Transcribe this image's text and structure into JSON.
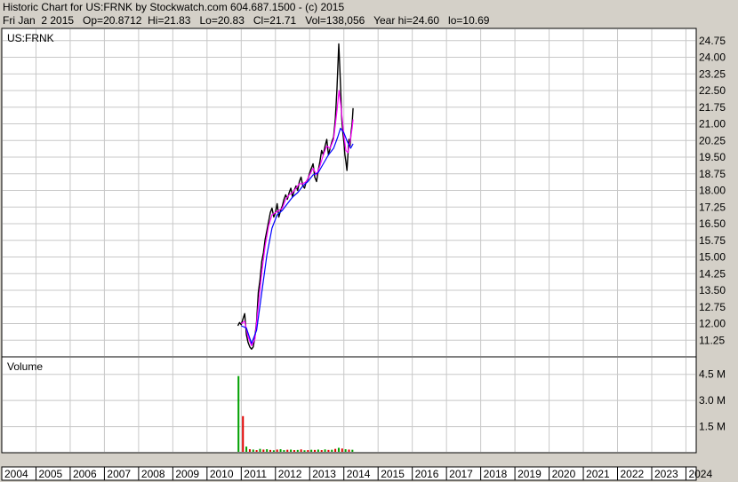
{
  "header": {
    "line1": "Historic Chart for US:FRNK by Stockwatch.com 604.687.1500 - (c) 2015",
    "line2": "Fri Jan  2 2015   Op=20.8712  Hi=21.83   Lo=20.83   Cl=21.71   Vol=138,056   Year hi=24.60   lo=10.69"
  },
  "colors": {
    "background": "#d4d0c8",
    "plot": "#ffffff",
    "grid": "#c8c8c8",
    "price": "#000000",
    "ma_short": "#ff00ff",
    "ma_long": "#0000ff",
    "vol_up": "#00a000",
    "vol_down": "#e00000"
  },
  "chart_data": [
    {
      "type": "line",
      "title": "US:FRNK",
      "y_ticks": [
        "24.75",
        "24.00",
        "23.25",
        "22.50",
        "21.75",
        "21.00",
        "20.25",
        "19.50",
        "18.75",
        "18.00",
        "17.25",
        "16.50",
        "15.75",
        "15.00",
        "14.25",
        "13.50",
        "12.75",
        "12.00",
        "11.25"
      ],
      "ylim": [
        10.5,
        25.3
      ],
      "xlim": [
        2004.0,
        2024.3
      ],
      "grid": true,
      "series": [
        {
          "values": [
            [
              2010.9,
              11.9
            ],
            [
              2010.95,
              12.05
            ],
            [
              2011.0,
              11.95
            ],
            [
              2011.05,
              12.2
            ],
            [
              2011.1,
              12.45
            ],
            [
              2011.15,
              11.5
            ],
            [
              2011.2,
              11.15
            ],
            [
              2011.25,
              10.95
            ],
            [
              2011.3,
              10.85
            ],
            [
              2011.35,
              10.95
            ],
            [
              2011.4,
              11.4
            ],
            [
              2011.45,
              12.1
            ],
            [
              2011.5,
              13.4
            ],
            [
              2011.55,
              14.0
            ],
            [
              2011.6,
              14.8
            ],
            [
              2011.65,
              15.2
            ],
            [
              2011.7,
              15.8
            ],
            [
              2011.75,
              16.2
            ],
            [
              2011.8,
              16.6
            ],
            [
              2011.85,
              17.0
            ],
            [
              2011.9,
              17.2
            ],
            [
              2011.95,
              16.8
            ],
            [
              2012.0,
              17.0
            ],
            [
              2012.05,
              17.4
            ],
            [
              2012.1,
              16.8
            ],
            [
              2012.15,
              17.1
            ],
            [
              2012.2,
              17.3
            ],
            [
              2012.25,
              17.6
            ],
            [
              2012.3,
              17.8
            ],
            [
              2012.35,
              17.6
            ],
            [
              2012.4,
              17.9
            ],
            [
              2012.45,
              18.1
            ],
            [
              2012.5,
              17.7
            ],
            [
              2012.55,
              18.0
            ],
            [
              2012.6,
              18.2
            ],
            [
              2012.65,
              18.0
            ],
            [
              2012.7,
              18.4
            ],
            [
              2012.75,
              18.6
            ],
            [
              2012.8,
              18.2
            ],
            [
              2012.85,
              18.1
            ],
            [
              2012.9,
              18.4
            ],
            [
              2012.95,
              18.5
            ],
            [
              2013.0,
              18.8
            ],
            [
              2013.05,
              19.0
            ],
            [
              2013.1,
              19.2
            ],
            [
              2013.15,
              18.6
            ],
            [
              2013.2,
              18.4
            ],
            [
              2013.25,
              18.9
            ],
            [
              2013.3,
              19.3
            ],
            [
              2013.35,
              19.8
            ],
            [
              2013.4,
              19.6
            ],
            [
              2013.45,
              20.0
            ],
            [
              2013.5,
              20.3
            ],
            [
              2013.55,
              19.6
            ],
            [
              2013.6,
              19.9
            ],
            [
              2013.65,
              20.2
            ],
            [
              2013.7,
              20.4
            ],
            [
              2013.75,
              21.2
            ],
            [
              2013.8,
              22.6
            ],
            [
              2013.85,
              24.6
            ],
            [
              2013.88,
              23.6
            ],
            [
              2013.91,
              22.4
            ],
            [
              2013.94,
              21.2
            ],
            [
              2013.97,
              20.6
            ],
            [
              2014.0,
              20.2
            ],
            [
              2014.03,
              19.6
            ],
            [
              2014.06,
              19.3
            ],
            [
              2014.09,
              18.9
            ],
            [
              2014.12,
              19.6
            ],
            [
              2014.15,
              20.3
            ],
            [
              2014.18,
              20.0
            ],
            [
              2014.21,
              20.6
            ],
            [
              2014.24,
              21.0
            ],
            [
              2014.27,
              21.71
            ]
          ]
        },
        {
          "values": [
            [
              2011.0,
              12.0
            ],
            [
              2011.1,
              12.1
            ],
            [
              2011.2,
              11.4
            ],
            [
              2011.3,
              11.0
            ],
            [
              2011.4,
              11.3
            ],
            [
              2011.5,
              12.8
            ],
            [
              2011.6,
              14.3
            ],
            [
              2011.7,
              15.5
            ],
            [
              2011.8,
              16.4
            ],
            [
              2011.9,
              16.9
            ],
            [
              2012.0,
              17.0
            ],
            [
              2012.1,
              17.1
            ],
            [
              2012.2,
              17.2
            ],
            [
              2012.3,
              17.6
            ],
            [
              2012.4,
              17.8
            ],
            [
              2012.5,
              17.9
            ],
            [
              2012.6,
              18.1
            ],
            [
              2012.7,
              18.3
            ],
            [
              2012.8,
              18.3
            ],
            [
              2012.9,
              18.4
            ],
            [
              2013.0,
              18.7
            ],
            [
              2013.1,
              19.0
            ],
            [
              2013.2,
              18.7
            ],
            [
              2013.3,
              19.1
            ],
            [
              2013.4,
              19.6
            ],
            [
              2013.5,
              20.0
            ],
            [
              2013.6,
              19.9
            ],
            [
              2013.7,
              20.3
            ],
            [
              2013.8,
              21.6
            ],
            [
              2013.86,
              22.5
            ],
            [
              2013.93,
              21.6
            ],
            [
              2014.0,
              20.5
            ],
            [
              2014.06,
              19.8
            ],
            [
              2014.12,
              19.7
            ],
            [
              2014.18,
              20.2
            ],
            [
              2014.24,
              20.8
            ],
            [
              2014.27,
              21.2
            ]
          ]
        },
        {
          "values": [
            [
              2011.0,
              11.9
            ],
            [
              2011.15,
              11.8
            ],
            [
              2011.3,
              11.1
            ],
            [
              2011.45,
              11.7
            ],
            [
              2011.6,
              13.4
            ],
            [
              2011.75,
              15.1
            ],
            [
              2011.9,
              16.3
            ],
            [
              2012.05,
              16.9
            ],
            [
              2012.2,
              17.1
            ],
            [
              2012.35,
              17.4
            ],
            [
              2012.5,
              17.7
            ],
            [
              2012.65,
              17.9
            ],
            [
              2012.8,
              18.2
            ],
            [
              2012.95,
              18.4
            ],
            [
              2013.1,
              18.7
            ],
            [
              2013.25,
              18.8
            ],
            [
              2013.4,
              19.2
            ],
            [
              2013.55,
              19.6
            ],
            [
              2013.7,
              19.9
            ],
            [
              2013.82,
              20.4
            ],
            [
              2013.9,
              20.8
            ],
            [
              2014.0,
              20.6
            ],
            [
              2014.1,
              20.2
            ],
            [
              2014.2,
              19.9
            ],
            [
              2014.27,
              20.1
            ]
          ]
        }
      ]
    },
    {
      "type": "bar",
      "title": "Volume",
      "y_ticks": [
        "4.5 M",
        "3.0 M",
        "1.5 M"
      ],
      "ylim": [
        0,
        5.3
      ],
      "grid": true,
      "series": [
        {
          "values": [
            [
              2010.92,
              4.4,
              "up"
            ],
            [
              2011.05,
              2.1,
              "down"
            ],
            [
              2011.15,
              0.35,
              "up"
            ],
            [
              2011.25,
              0.2,
              "down"
            ],
            [
              2011.35,
              0.18,
              "up"
            ],
            [
              2011.45,
              0.15,
              "down"
            ],
            [
              2011.55,
              0.22,
              "up"
            ],
            [
              2011.65,
              0.18,
              "down"
            ],
            [
              2011.75,
              0.2,
              "up"
            ],
            [
              2011.85,
              0.16,
              "down"
            ],
            [
              2011.95,
              0.14,
              "up"
            ],
            [
              2012.05,
              0.18,
              "down"
            ],
            [
              2012.15,
              0.2,
              "up"
            ],
            [
              2012.25,
              0.15,
              "up"
            ],
            [
              2012.35,
              0.17,
              "down"
            ],
            [
              2012.45,
              0.18,
              "up"
            ],
            [
              2012.55,
              0.15,
              "down"
            ],
            [
              2012.65,
              0.16,
              "up"
            ],
            [
              2012.75,
              0.19,
              "down"
            ],
            [
              2012.85,
              0.14,
              "up"
            ],
            [
              2012.95,
              0.15,
              "down"
            ],
            [
              2013.05,
              0.17,
              "up"
            ],
            [
              2013.15,
              0.16,
              "down"
            ],
            [
              2013.25,
              0.18,
              "up"
            ],
            [
              2013.35,
              0.15,
              "down"
            ],
            [
              2013.45,
              0.19,
              "up"
            ],
            [
              2013.55,
              0.16,
              "down"
            ],
            [
              2013.65,
              0.17,
              "up"
            ],
            [
              2013.75,
              0.22,
              "down"
            ],
            [
              2013.85,
              0.28,
              "up"
            ],
            [
              2013.95,
              0.24,
              "down"
            ],
            [
              2014.05,
              0.2,
              "up"
            ],
            [
              2014.15,
              0.18,
              "down"
            ],
            [
              2014.25,
              0.17,
              "up"
            ]
          ]
        }
      ]
    }
  ],
  "x_ticks": [
    "2004",
    "2005",
    "2006",
    "2007",
    "2008",
    "2009",
    "2010",
    "2011",
    "2012",
    "2013",
    "2014",
    "2015",
    "2016",
    "2017",
    "2018",
    "2019",
    "2020",
    "2021",
    "2022",
    "2023",
    "2024"
  ]
}
